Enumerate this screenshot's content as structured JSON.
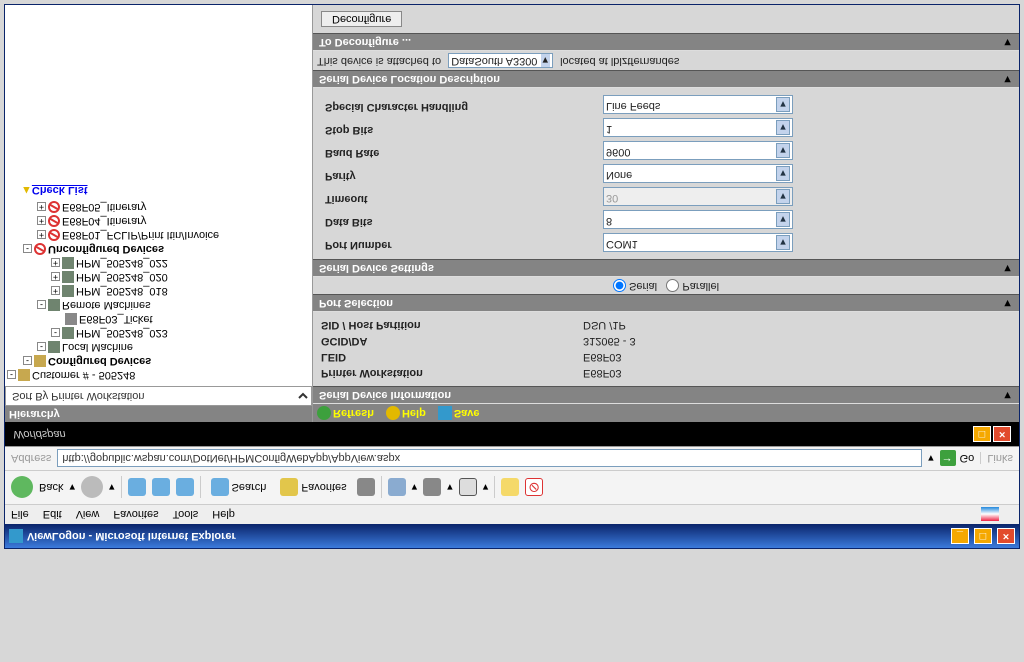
{
  "window_title": "ViewLogon - Microsoft Internet Explorer",
  "menu": [
    "File",
    "Edit",
    "View",
    "Favorites",
    "Tools",
    "Help"
  ],
  "tb": {
    "back": "Back",
    "search": "Search",
    "favorites": "Favorites"
  },
  "addr_label": "Address",
  "url": "http://gopublic.wspan.com/DotNet/HPMConfigWebApp/AppView.aspx",
  "go": "Go",
  "links": "Links",
  "brand": "Worldspan",
  "side_title": "Hierarchy",
  "sort": "Sort By Printer Workstation",
  "tree": {
    "customer": "Customer # - 505248",
    "configured": "Configured Devices",
    "local": "Local Machine",
    "hpm023": "HPM_505248_023",
    "ticket": "E68F03_Ticket",
    "remote": "Remote Machines",
    "hpm018": "HPM_505248_018",
    "hpm020": "HPM_505248_020",
    "hpm022": "HPM_505248_022",
    "unconf": "Unconfigured Devices",
    "fclip": "E68F01_FCLIP/Print Itin/Invoice",
    "itin04": "E68F04_Itinerary",
    "itin05": "E68F05_Itinerary"
  },
  "chk": "Check List",
  "mt": {
    "refresh": "Refresh",
    "help": "Help",
    "save": "Save"
  },
  "sect": {
    "info": "Serial Device Information",
    "port": "Port Selection",
    "settings": "Serial Device Settings",
    "loc": "Serial Device Location Description",
    "deconf": "To Deconfigure ..."
  },
  "info": {
    "pw_l": "Printer Workstation",
    "pw_v": "E68F03",
    "leid_l": "LEID",
    "leid_v": "E68F03",
    "gc_l": "GCID/DA",
    "gc_v": "312065 - 3",
    "sid_l": "SID / Host Partition",
    "sid_v": "DSU /1P"
  },
  "ports": {
    "serial": "Serial",
    "parallel": "Parallel"
  },
  "set": {
    "portnum_l": "Port Number",
    "portnum_v": "COM1",
    "db_l": "Data Bits",
    "db_v": "8",
    "to_l": "Timeout",
    "to_v": "30",
    "par_l": "Parity",
    "par_v": "None",
    "baud_l": "Baud Rate",
    "baud_v": "9600",
    "sb_l": "Stop Bits",
    "sb_v": "1",
    "sch_l": "Special Character Handling",
    "sch_v": "Line Feeds"
  },
  "loc": {
    "pre": "This device is attached to",
    "printer": "DataSouth A3300",
    "post": "located at lblztfernandes"
  },
  "decfg_btn": "Deconfigure"
}
